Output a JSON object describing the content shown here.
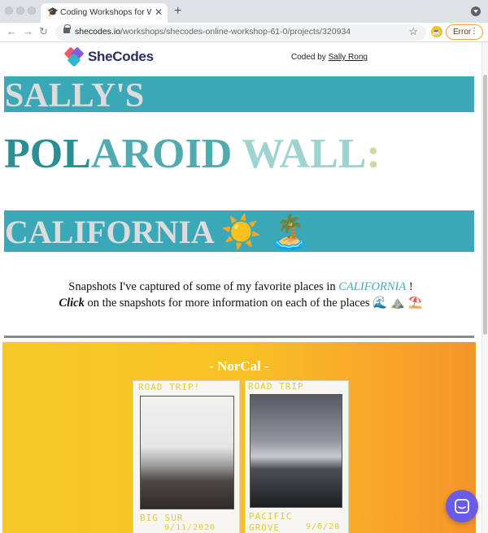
{
  "browser": {
    "tab_title": "Coding Workshops for Women",
    "tab_favicon": "🎓",
    "tab_close": "✕",
    "new_tab": "+",
    "url_domain": "shecodes.io",
    "url_path": "/workshops/shecodes-online-workshop-61-0/projects/320934",
    "error_label": "Error",
    "icons": {
      "back": "back-arrow-icon",
      "forward": "forward-arrow-icon",
      "reload": "reload-icon",
      "lock": "lock-icon",
      "star": "star-icon",
      "extension": "extension-icon",
      "more": "kebab-menu-icon"
    }
  },
  "header": {
    "brand": "SheCodes",
    "coded_by_prefix": "Coded by",
    "author": "Sally Rong"
  },
  "page": {
    "banner1": "SALLY'S",
    "title_parts": [
      {
        "text": "POL",
        "color": "#2b8f91"
      },
      {
        "text": "AROID",
        "color": "#51aab0"
      },
      {
        "text": " WALL",
        "color": "#9fd3cf"
      },
      {
        "text": ":",
        "color": "#d4d6a6"
      }
    ],
    "banner2": "CALIFORNIA ☀️ 🏝️",
    "intro_line1_before": "Snapshots I've captured of some of my favorite places in",
    "intro_line1_highlight": "CALIFORNIA",
    "intro_line1_after": "!",
    "intro_line2_bold": "Click",
    "intro_line2_rest": "on the snapshots for more information on each of the places 🌊 ⛰️ ⛱️",
    "section_title": "- NorCal -",
    "photos": [
      {
        "top_label": "ROAD TRIP!",
        "bottom_label": "BIG SUR",
        "date": "9/11/2020"
      },
      {
        "top_label": "ROAD TRIP",
        "bottom_label": "PACIFIC",
        "bottom_label2": "GROVE",
        "date": "9/6/20"
      }
    ]
  },
  "colors": {
    "banner": "#3aa8b6",
    "banner_text": "#dcdcdc",
    "norcal_start": "#f6c928",
    "norcal_end": "#f59529",
    "chat": "#6b5ce7"
  }
}
